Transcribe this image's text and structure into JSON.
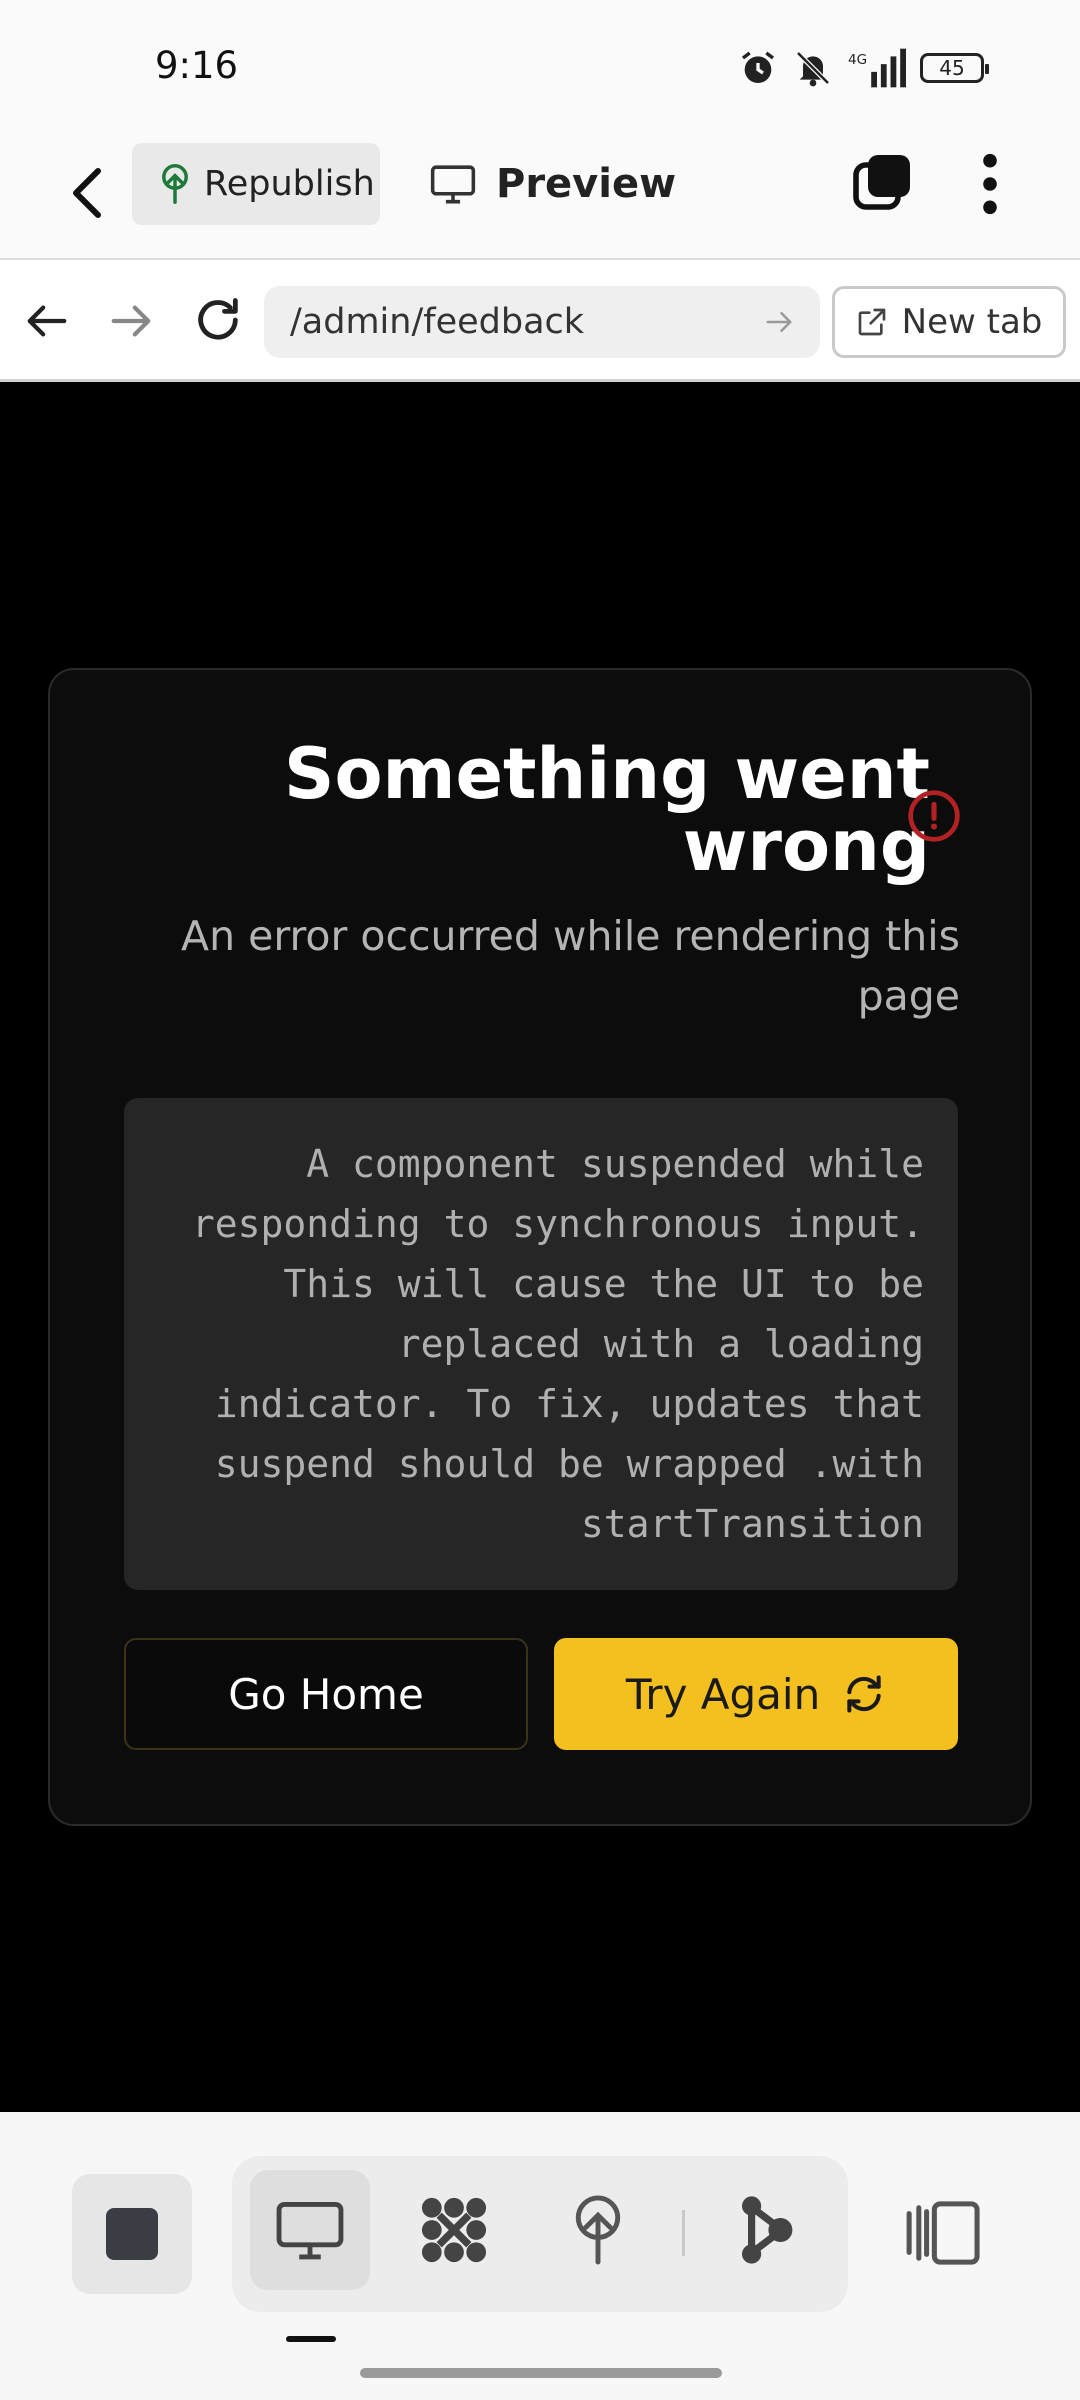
{
  "status_bar": {
    "time": "9:16",
    "battery": "45"
  },
  "header": {
    "republish_label": "Republish",
    "preview_label": "Preview"
  },
  "browser": {
    "url": "/admin/feedback",
    "new_tab_label": "New tab"
  },
  "error": {
    "title": "Something went wrong",
    "subtitle": "An error occurred while rendering this page",
    "message": "A component suspended while responding to synchronous input. This will cause the UI to be replaced with a loading indicator. To fix, updates that suspend should be wrapped .with startTransition",
    "go_home_label": "Go Home",
    "try_again_label": "Try Again"
  },
  "colors": {
    "accent": "#f4c020",
    "error_red": "#b22222",
    "brand_green": "#1f7a3a"
  }
}
